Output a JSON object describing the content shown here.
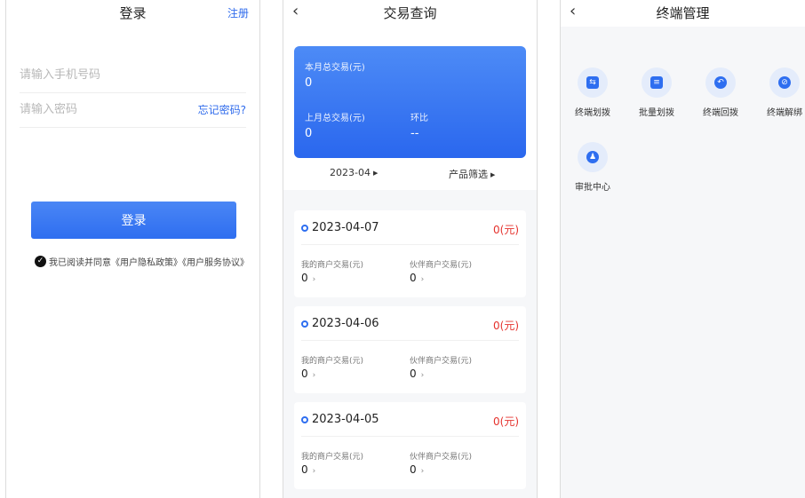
{
  "login": {
    "title": "登录",
    "register": "注册",
    "phone_placeholder": "请输入手机号码",
    "password_placeholder": "请输入密码",
    "forgot": "忘记密码?",
    "login_button": "登录",
    "agreement": "我已阅读并同意《用户隐私政策》《用户服务协议》"
  },
  "trade": {
    "back": "‹",
    "title": "交易查询",
    "month_label": "本月总交易(元)",
    "month_value": "0",
    "last_month_label": "上月总交易(元)",
    "last_month_value": "0",
    "ratio_label": "环比",
    "ratio_value": "--",
    "month_filter": "2023-04",
    "product_filter": "产品筛选",
    "days": [
      {
        "date": "2023-04-07",
        "amount": "0(元)",
        "my_label": "我的商户交易(元)",
        "my_value": "0",
        "partner_label": "伙伴商户交易(元)",
        "partner_value": "0"
      },
      {
        "date": "2023-04-06",
        "amount": "0(元)",
        "my_label": "我的商户交易(元)",
        "my_value": "0",
        "partner_label": "伙伴商户交易(元)",
        "partner_value": "0"
      },
      {
        "date": "2023-04-05",
        "amount": "0(元)",
        "my_label": "我的商户交易(元)",
        "my_value": "0",
        "partner_label": "伙伴商户交易(元)",
        "partner_value": "0"
      }
    ]
  },
  "terminal": {
    "back": "‹",
    "title": "终端管理",
    "items": [
      {
        "label": "终端划拨",
        "icon": "transfer-icon"
      },
      {
        "label": "批量划拨",
        "icon": "batch-icon"
      },
      {
        "label": "终端回拨",
        "icon": "return-icon"
      },
      {
        "label": "终端解绑",
        "icon": "unbind-icon"
      },
      {
        "label": "审批中心",
        "icon": "approval-icon"
      }
    ]
  },
  "colors": {
    "accent": "#2e6ef0",
    "danger": "#e5322d"
  }
}
